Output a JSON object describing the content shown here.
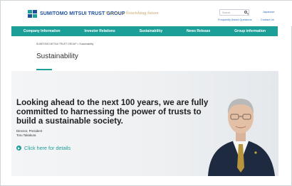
{
  "header": {
    "logo_text": "SUMITOMO MITSUI TRUST GROUP",
    "tagline": "Trust for a flourishing future",
    "search_placeholder": "Search",
    "language": "Japanese",
    "faq": "Frequently Asked Questions",
    "contact": "Contact Us",
    "brand_color": "#1e4f9b"
  },
  "nav": {
    "items": [
      "Company Information",
      "Investor Relations",
      "Sustainability",
      "News Release",
      "Group information"
    ],
    "color": "#1b9f97"
  },
  "breadcrumb": "SUMITOMO MITSUI TRUST GROUP > Sustainability",
  "page_title": "Sustainability",
  "hero": {
    "headline": "Looking ahead to the next 100 years, we are fully committed to harnessing the power of trusts to build a sustainable society.",
    "role": "Director, President",
    "name": "Toru Takakura",
    "cta_label": "Click here for details",
    "cta_icon": "arrow-circle-icon"
  }
}
